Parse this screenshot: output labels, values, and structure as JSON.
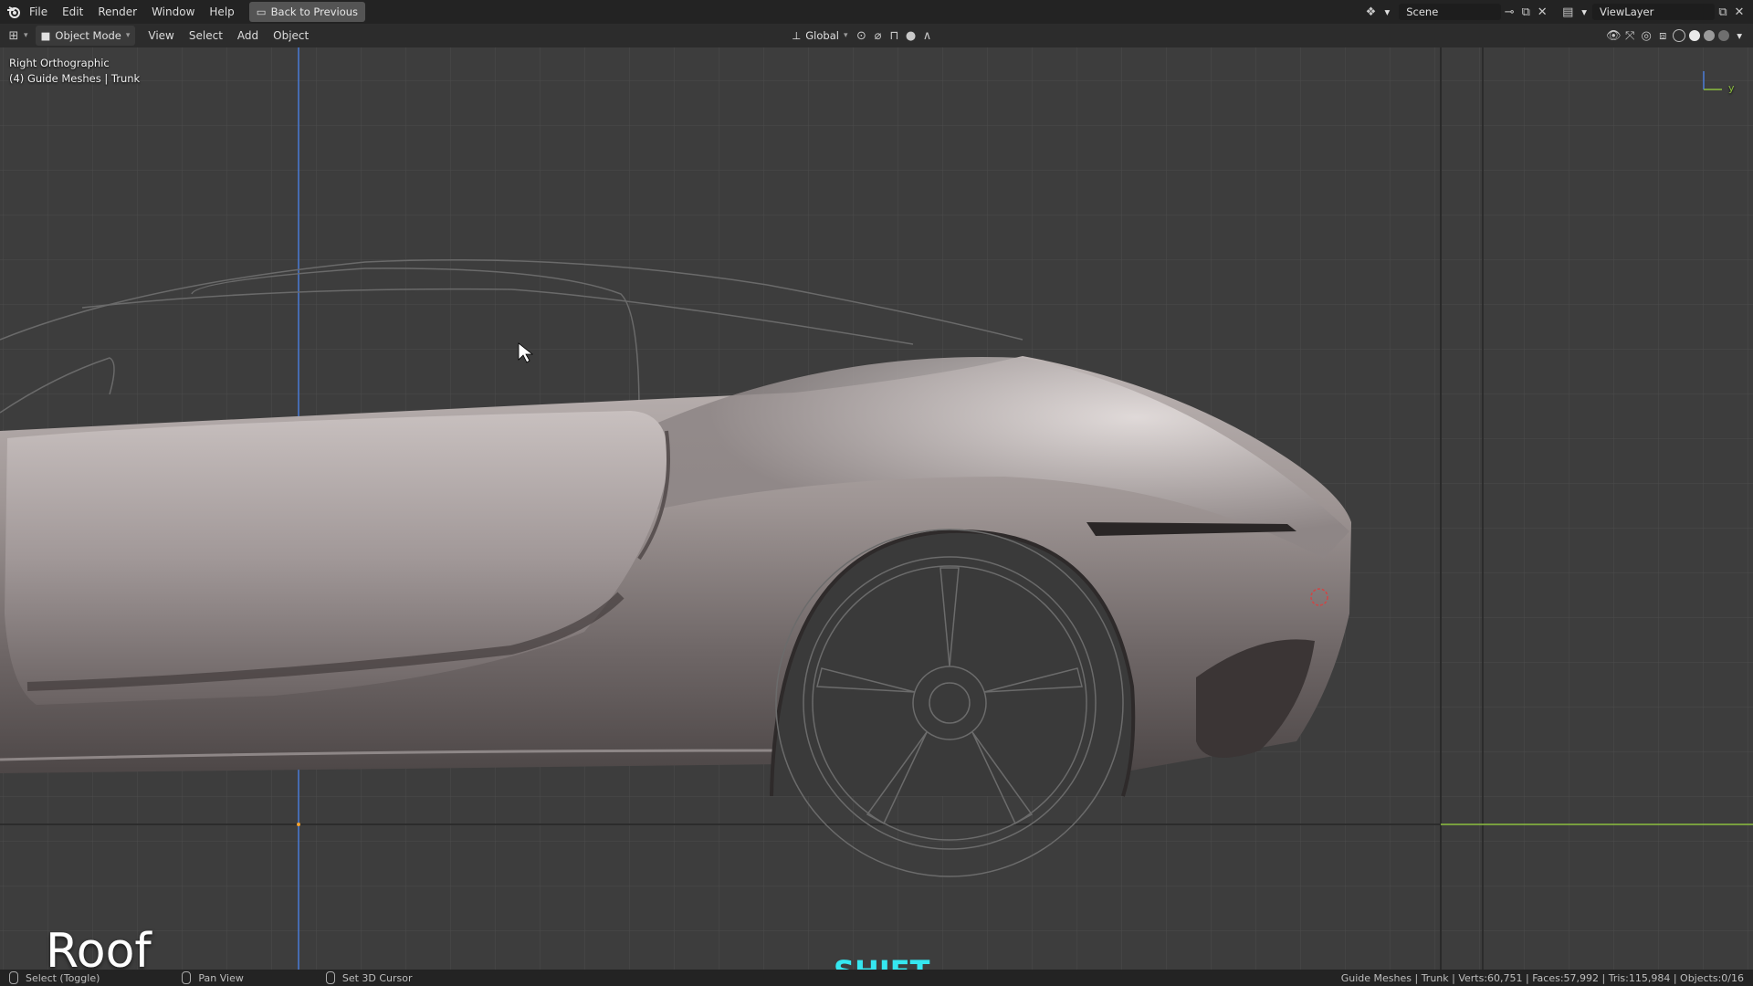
{
  "topbar": {
    "menus": [
      "File",
      "Edit",
      "Render",
      "Window",
      "Help"
    ],
    "back_button": "Back to Previous",
    "scene_name": "Scene",
    "view_layer": "ViewLayer"
  },
  "header": {
    "mode": "Object Mode",
    "menus": [
      "View",
      "Select",
      "Add",
      "Object"
    ],
    "transform_orientation": "Global"
  },
  "viewport": {
    "view_name": "Right Orthographic",
    "collection_info": "(4) Guide Meshes | Trunk",
    "gizmo_axis": "y",
    "caption_left": "Roof",
    "caption_key": "SHIFT",
    "caption_key_color": "#35e7f0"
  },
  "statusbar": {
    "select_label": "Select (Toggle)",
    "pan_label": "Pan View",
    "cursor_label": "Set 3D Cursor",
    "stats": "Guide Meshes | Trunk | Verts:60,751 | Faces:57,992 | Tris:115,984 | Objects:0/16"
  },
  "colors": {
    "grid_bg": "#3d3d3d",
    "x_axis_line": "#4a7bd6",
    "y_axis_line": "#8cbf3f",
    "car_body": "#8b8282"
  }
}
